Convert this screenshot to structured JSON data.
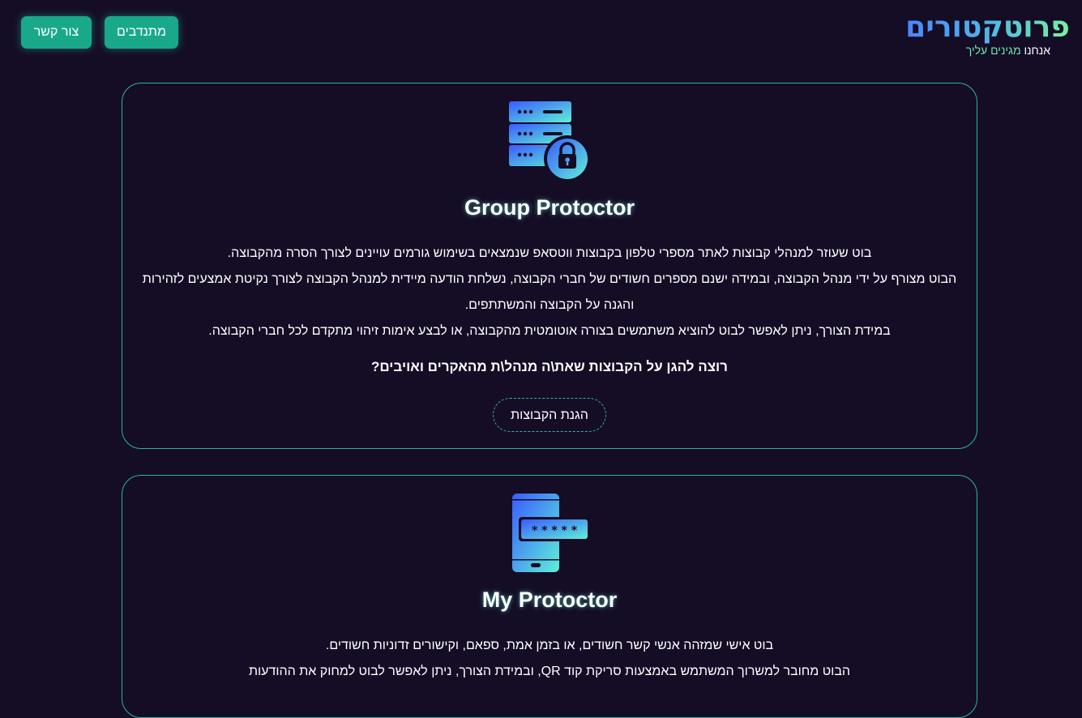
{
  "header": {
    "contact_label": "צור קשר",
    "volunteers_label": "מתנדבים",
    "logo_title": "פרוטקטורים",
    "logo_tagline_a": "אנחנו",
    "logo_tagline_b": "מגינים עליך"
  },
  "cards": [
    {
      "icon": "server-lock-icon",
      "title": "Group Protoctor",
      "description": [
        "בוט שעוזר למנהלי קבוצות לאתר מספרי טלפון בקבוצות ווטסאפ שנמצאים בשימוש גורמים עויינים לצורך הסרה מהקבוצה.",
        "הבוט מצורף על ידי מנהל הקבוצה, ובמידה ישנם מספרים חשודים של חברי הקבוצה, נשלחת הודעה מיידית למנהל הקבוצה לצורך נקיטת אמצעים לזהירות והגנה על הקבוצה והמשתתפים.",
        "במידת הצורך, ניתן לאפשר לבוט להוציא משתמשים בצורה אוטומטית מהקבוצה, או לבצע אימות זיהוי מתקדם לכל חברי הקבוצה."
      ],
      "question": "רוצה להגן על הקבוצות שאת\\ה מנהל\\ת מהאקרים ואויבים?",
      "cta_label": "הגנת הקבוצות"
    },
    {
      "icon": "phone-password-icon",
      "title": "My Protoctor",
      "description": [
        "בוט אישי שמזהה אנשי קשר חשודים, או בזמן אמת, ספאם, וקישורים זדוניות חשודים.",
        "הבוט מחובר למשרוך המשתמש באמצעות סריקת קוד QR, ובמידת הצורך, ניתן לאפשר לבוט למחוק את ההודעות"
      ]
    }
  ],
  "colors": {
    "background": "#150d26",
    "accent": "#19a98a",
    "card_border": "#2bb5a0",
    "logo_gradient_start": "#4a7cff",
    "logo_gradient_end": "#7af0a0"
  }
}
